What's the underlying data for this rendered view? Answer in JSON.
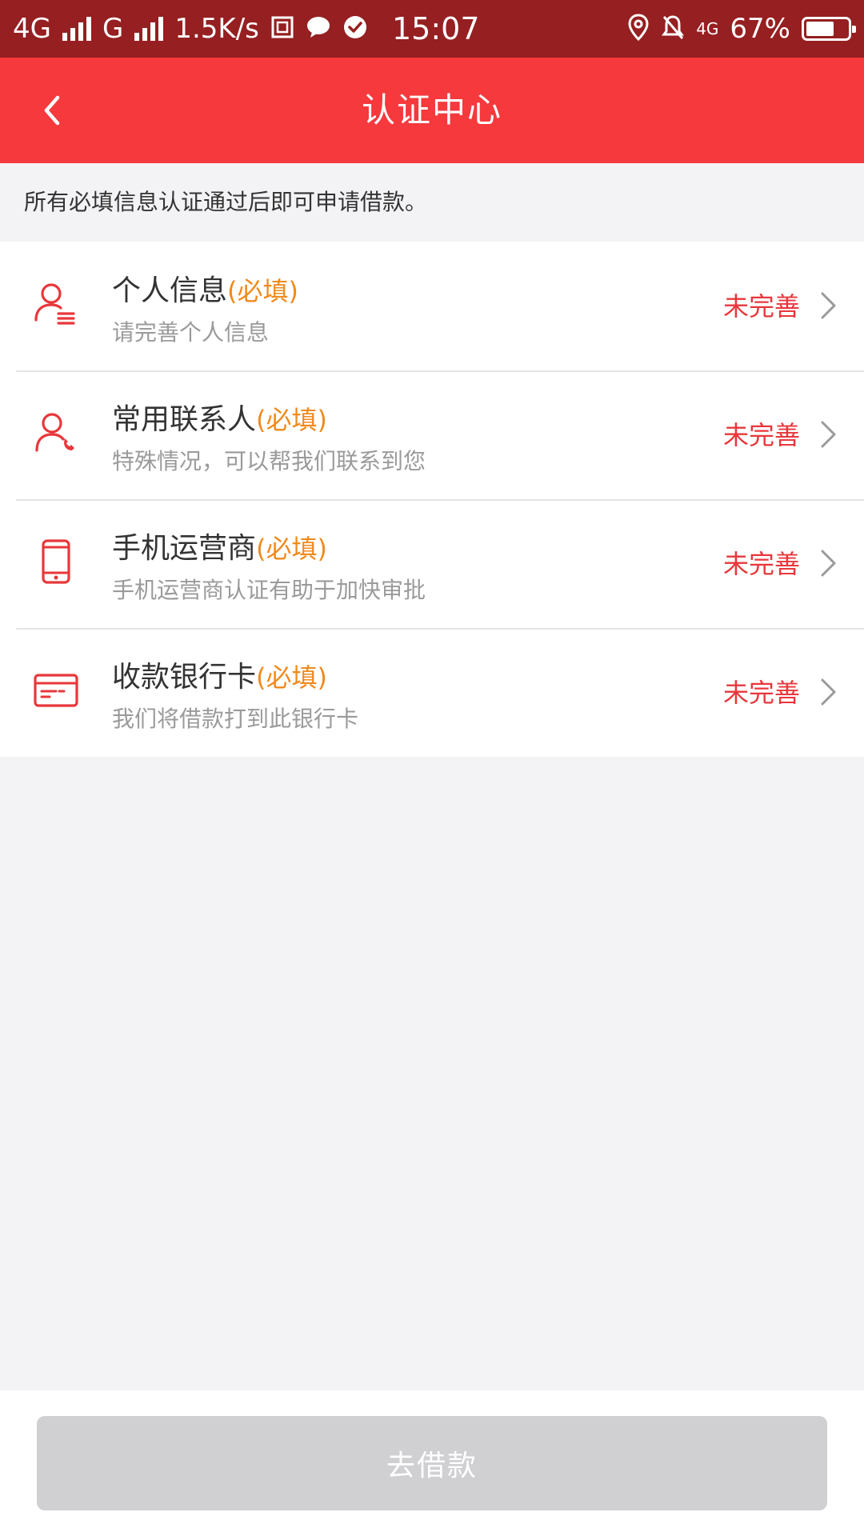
{
  "status_bar": {
    "net1": "4G",
    "net2": "G",
    "speed": "1.5K/s",
    "time": "15:07",
    "net3": "4G",
    "battery": "67%",
    "battery_level": 0.67
  },
  "app_bar": {
    "title": "认证中心"
  },
  "notice": "所有必填信息认证通过后即可申请借款。",
  "items": [
    {
      "icon": "user-list-icon",
      "title": "个人信息",
      "required": "(必填)",
      "subtitle": "请完善个人信息",
      "status": "未完善"
    },
    {
      "icon": "user-phone-icon",
      "title": "常用联系人",
      "required": "(必填)",
      "subtitle": "特殊情况，可以帮我们联系到您",
      "status": "未完善"
    },
    {
      "icon": "mobile-phone-icon",
      "title": "手机运营商",
      "required": "(必填)",
      "subtitle": "手机运营商认证有助于加快审批",
      "status": "未完善"
    },
    {
      "icon": "bank-card-icon",
      "title": "收款银行卡",
      "required": "(必填)",
      "subtitle": "我们将借款打到此银行卡",
      "status": "未完善"
    }
  ],
  "cta": {
    "label": "去借款",
    "enabled": false
  },
  "colors": {
    "status_bar": "#951f21",
    "app_bar": "#f5393d",
    "accent_red": "#e8373b",
    "required_orange": "#f08a1c",
    "button_disabled": "#d0d0d3"
  }
}
